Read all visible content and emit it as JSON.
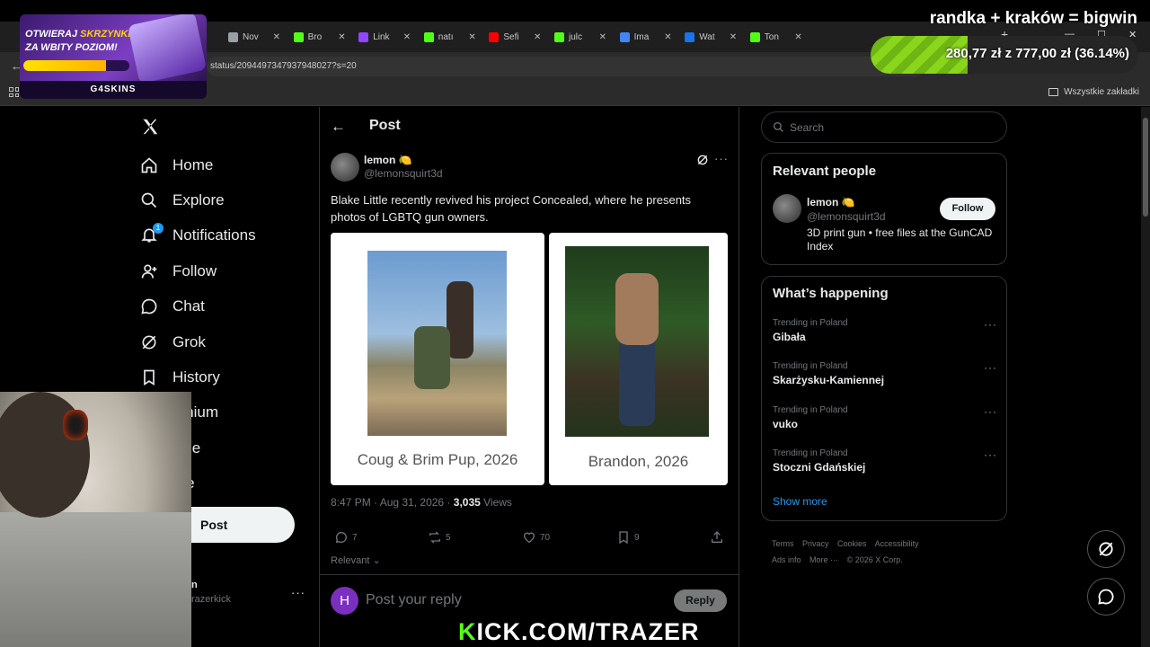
{
  "overlay": {
    "title": "randka + kraków = bigwin",
    "progress_text": "280,77 zł z 777,00 zł (36.14%)",
    "progress_fraction": 0.3614,
    "promo_line1_a": "OTWIERAJ ",
    "promo_line1_b": "SKRZYNKI EXP",
    "promo_line2": "ZA WBITY POZIOM!",
    "promo_brand": "G4SKINS",
    "kick_prefix": "K",
    "kick_rest": "ICK.COM/TRAZER"
  },
  "browser": {
    "tabs": [
      {
        "label": "Nov",
        "color": "#9aa0a6"
      },
      {
        "label": "Bro",
        "color": "#53fc18"
      },
      {
        "label": "Link",
        "color": "#9146ff"
      },
      {
        "label": "natı",
        "color": "#53fc18"
      },
      {
        "label": "Sefi",
        "color": "#ff0000"
      },
      {
        "label": "julc",
        "color": "#53fc18"
      },
      {
        "label": "Ima",
        "color": "#4285f4"
      },
      {
        "label": "Wat",
        "color": "#1a73e8"
      },
      {
        "label": "Ton",
        "color": "#53fc18"
      }
    ],
    "url": "status/2094497347937948027?s=20",
    "bookmarks_all": "Wszystkie zakładki"
  },
  "nav": {
    "items": [
      {
        "label": "Home",
        "icon": "home-icon"
      },
      {
        "label": "Explore",
        "icon": "search-icon"
      },
      {
        "label": "Notifications",
        "icon": "bell-icon",
        "badge": "1"
      },
      {
        "label": "Follow",
        "icon": "person-add-icon"
      },
      {
        "label": "Chat",
        "icon": "chat-icon"
      },
      {
        "label": "Grok",
        "icon": "grok-icon"
      },
      {
        "label": "History",
        "icon": "bookmark-icon"
      },
      {
        "label": "emium",
        "icon": ""
      },
      {
        "label": "ofile",
        "icon": ""
      },
      {
        "label": "ore",
        "icon": ""
      }
    ],
    "post_button": "Post",
    "account_name": "n",
    "account_handle": "razerkick"
  },
  "post": {
    "header_title": "Post",
    "author_name": "lemon 🍋",
    "author_handle": "@lemonsquirt3d",
    "text": "Blake Little recently revived his project Concealed, where he presents photos of LGBTQ gun owners.",
    "captions": [
      "Coug & Brim Pup, 2026",
      "Brandon, 2026"
    ],
    "time": "8:47 PM · Aug 31, 2026 · ",
    "views_count": "3,035",
    "views_label": " Views",
    "replies": "7",
    "reposts": "5",
    "likes": "70",
    "bookmarks": "9",
    "sort_label": "Relevant",
    "reply_avatar_letter": "H",
    "reply_placeholder": "Post your reply",
    "reply_button": "Reply"
  },
  "sidebar": {
    "search_placeholder": "Search",
    "relevant_title": "Relevant people",
    "person_name": "lemon 🍋",
    "person_handle": "@lemonsquirt3d",
    "person_bio": "3D print gun • free files at the GunCAD Index",
    "follow_button": "Follow",
    "happening_title": "What’s happening",
    "trends": [
      {
        "context": "Trending in Poland",
        "name": "Gibała"
      },
      {
        "context": "Trending in Poland",
        "name": "Skarżysku-Kamiennej"
      },
      {
        "context": "Trending in Poland",
        "name": "vuko"
      },
      {
        "context": "Trending in Poland",
        "name": "Stoczni Gdańskiej"
      }
    ],
    "show_more": "Show more",
    "footer_links": [
      "Terms",
      "Privacy",
      "Cookies",
      "Accessibility",
      "Ads info",
      "More ···",
      "© 2026 X Corp."
    ]
  }
}
